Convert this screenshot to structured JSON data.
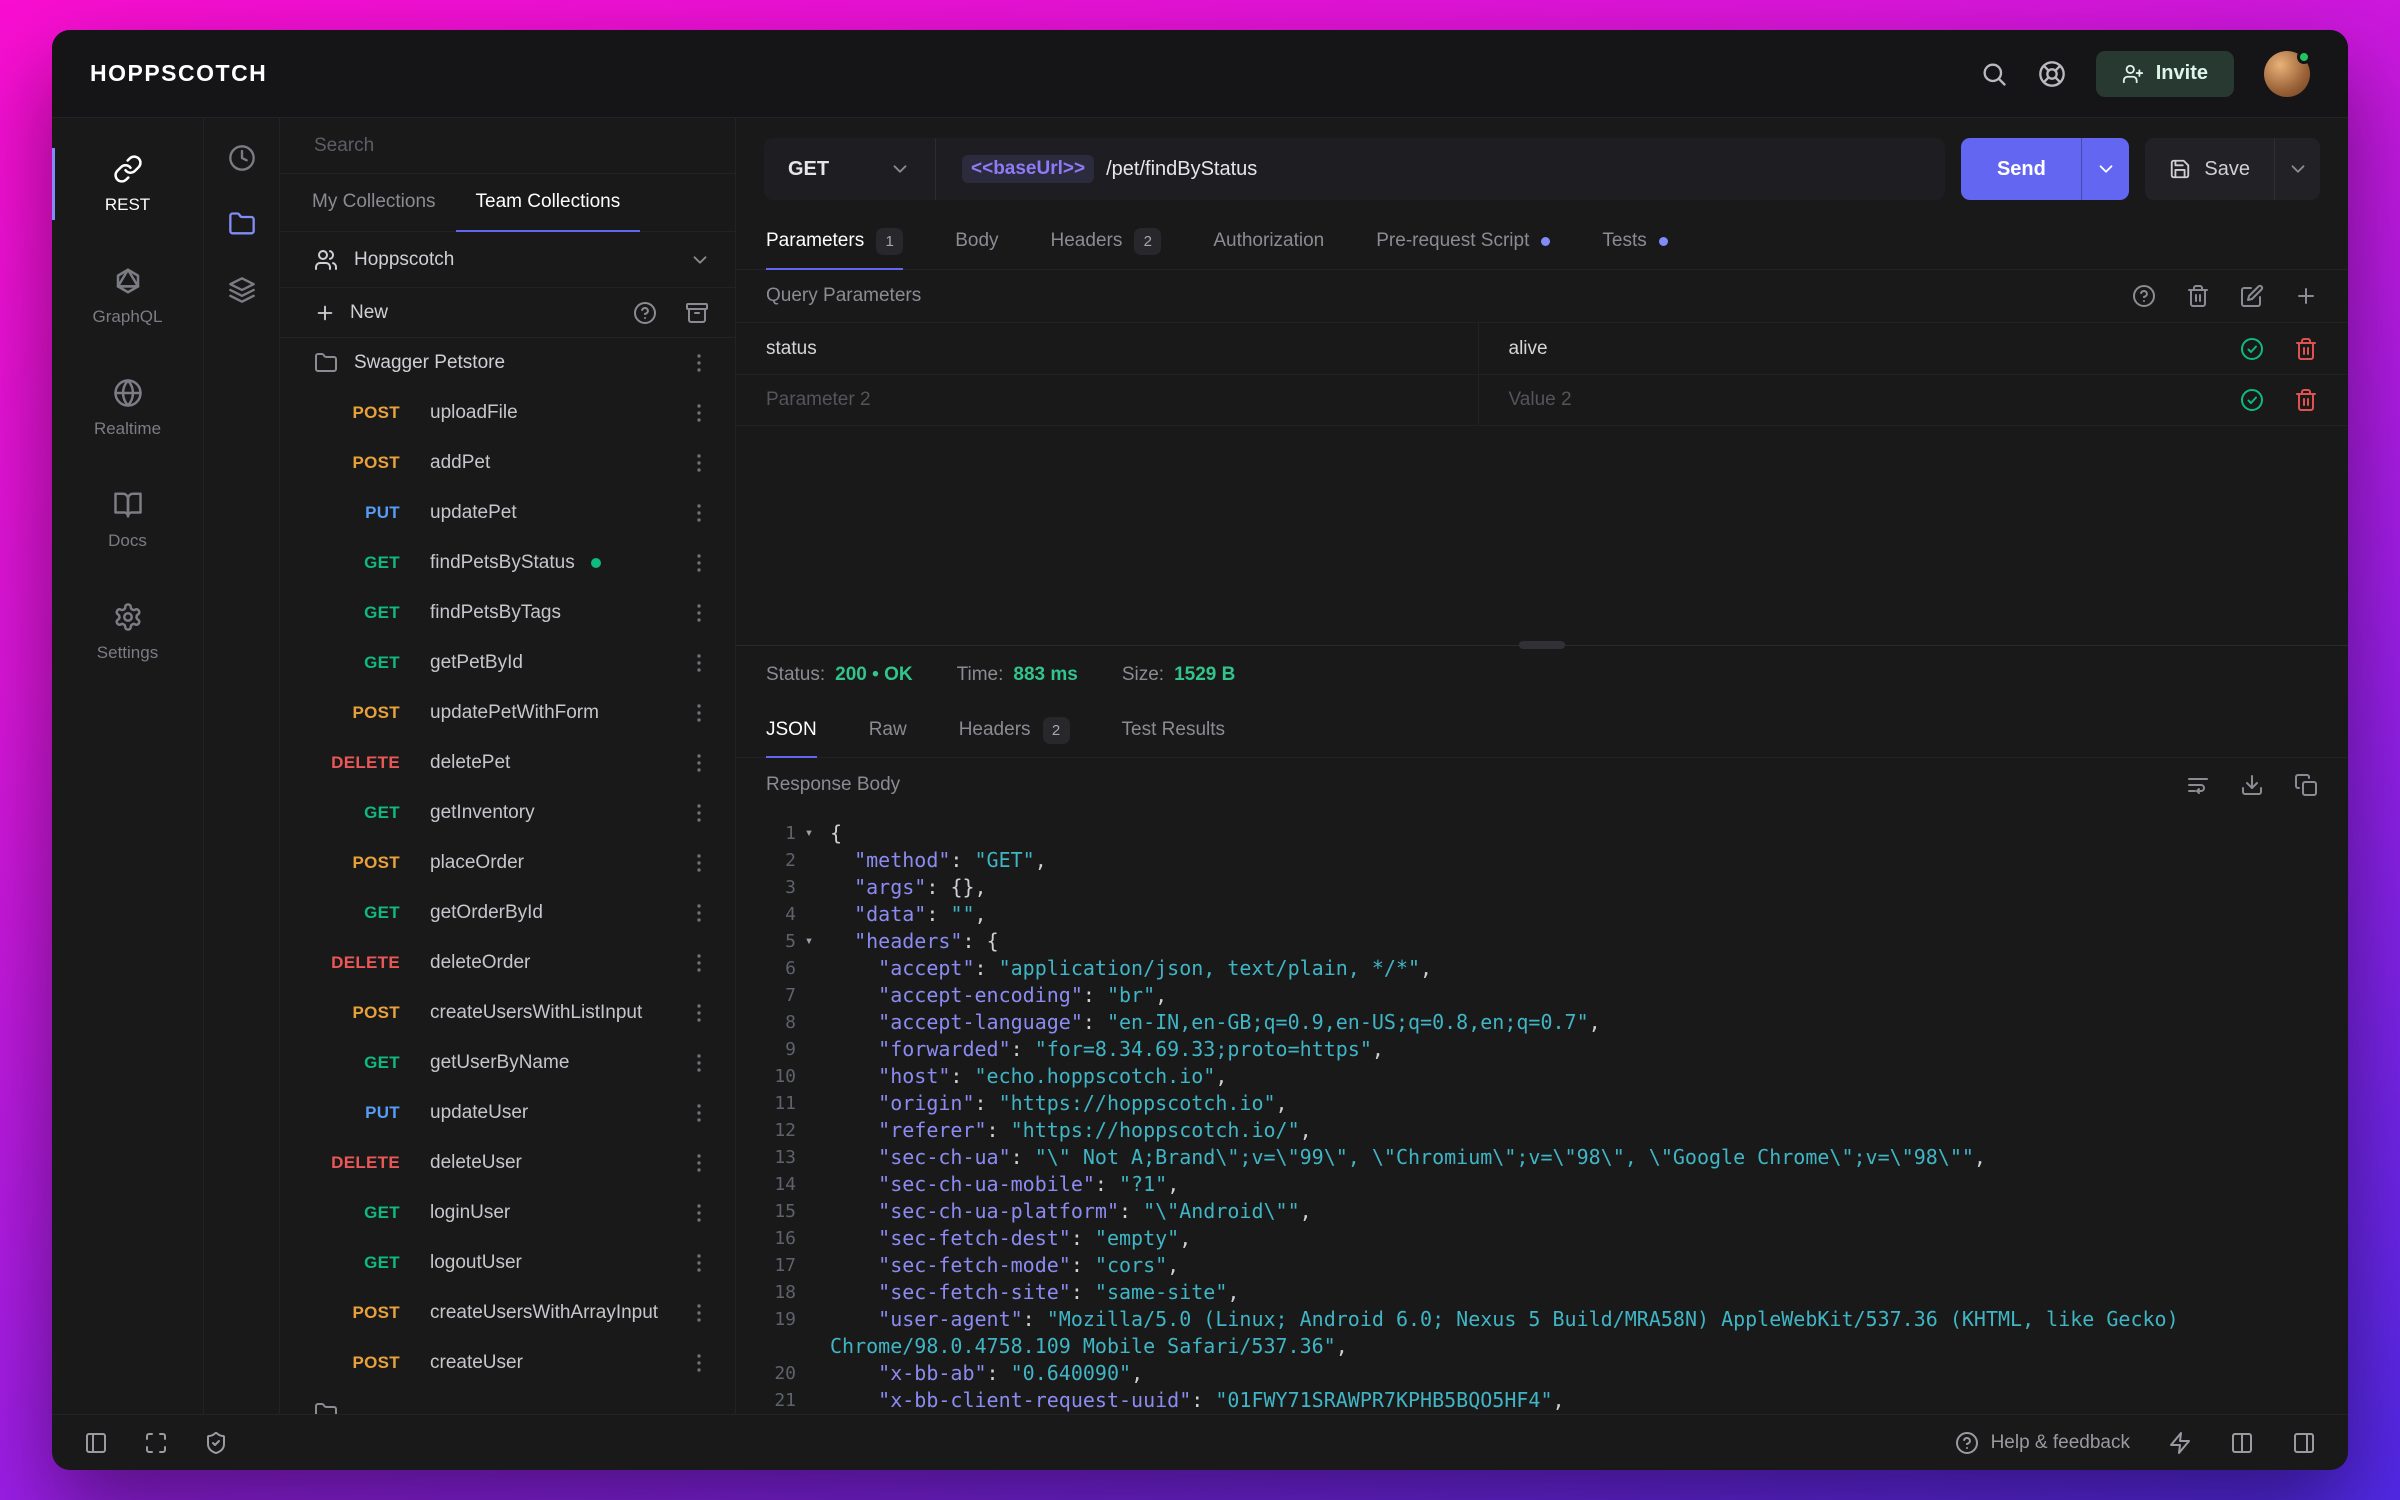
{
  "topbar": {
    "logo": "HOPPSCOTCH",
    "invite_label": "Invite"
  },
  "nav": {
    "items": [
      {
        "label": "REST",
        "icon": "link-icon",
        "active": true
      },
      {
        "label": "GraphQL",
        "icon": "graphql-icon",
        "active": false
      },
      {
        "label": "Realtime",
        "icon": "globe-icon",
        "active": false
      },
      {
        "label": "Docs",
        "icon": "book-icon",
        "active": false
      },
      {
        "label": "Settings",
        "icon": "gear-icon",
        "active": false
      }
    ]
  },
  "strip": {
    "items": [
      {
        "name": "history",
        "icon": "clock-icon",
        "active": false
      },
      {
        "name": "collections",
        "icon": "folder-icon",
        "active": true
      },
      {
        "name": "environments",
        "icon": "layers-icon",
        "active": false
      }
    ]
  },
  "collections": {
    "search_placeholder": "Search",
    "tabs": [
      {
        "label": "My Collections",
        "active": false
      },
      {
        "label": "Team Collections",
        "active": true
      }
    ],
    "team_name": "Hoppscotch",
    "new_label": "New",
    "folder_name": "Swagger Petstore",
    "requests": [
      {
        "method": "POST",
        "name": "uploadFile"
      },
      {
        "method": "POST",
        "name": "addPet"
      },
      {
        "method": "PUT",
        "name": "updatePet"
      },
      {
        "method": "GET",
        "name": "findPetsByStatus",
        "active": true
      },
      {
        "method": "GET",
        "name": "findPetsByTags"
      },
      {
        "method": "GET",
        "name": "getPetById"
      },
      {
        "method": "POST",
        "name": "updatePetWithForm"
      },
      {
        "method": "DELETE",
        "name": "deletePet"
      },
      {
        "method": "GET",
        "name": "getInventory"
      },
      {
        "method": "POST",
        "name": "placeOrder"
      },
      {
        "method": "GET",
        "name": "getOrderById"
      },
      {
        "method": "DELETE",
        "name": "deleteOrder"
      },
      {
        "method": "POST",
        "name": "createUsersWithListInput"
      },
      {
        "method": "GET",
        "name": "getUserByName"
      },
      {
        "method": "PUT",
        "name": "updateUser"
      },
      {
        "method": "DELETE",
        "name": "deleteUser"
      },
      {
        "method": "GET",
        "name": "loginUser"
      },
      {
        "method": "GET",
        "name": "logoutUser"
      },
      {
        "method": "POST",
        "name": "createUsersWithArrayInput"
      },
      {
        "method": "POST",
        "name": "createUser"
      }
    ],
    "has_partial_row": true
  },
  "request": {
    "method": "GET",
    "url_token": "<<baseUrl>>",
    "url_path": "/pet/findByStatus",
    "send_label": "Send",
    "save_label": "Save",
    "tabs": [
      {
        "label": "Parameters",
        "badge": "1",
        "active": true
      },
      {
        "label": "Body"
      },
      {
        "label": "Headers",
        "badge": "2"
      },
      {
        "label": "Authorization"
      },
      {
        "label": "Pre-request Script",
        "dot": true
      },
      {
        "label": "Tests",
        "dot": true
      }
    ],
    "section_title": "Query Parameters",
    "params": [
      {
        "key": "status",
        "value": "alive",
        "placeholder": false
      },
      {
        "key": "Parameter 2",
        "value": "Value 2",
        "placeholder": true
      }
    ]
  },
  "response": {
    "meta": [
      {
        "label": "Status:",
        "value": "200 • OK"
      },
      {
        "label": "Time:",
        "value": "883 ms"
      },
      {
        "label": "Size:",
        "value": "1529 B"
      }
    ],
    "tabs": [
      {
        "label": "JSON",
        "active": true
      },
      {
        "label": "Raw"
      },
      {
        "label": "Headers",
        "badge": "2"
      },
      {
        "label": "Test Results"
      }
    ],
    "body_label": "Response Body",
    "code_lines": [
      {
        "raw": "{",
        "fold": true
      },
      {
        "ind": 1,
        "key": "method",
        "val": "\"GET\"",
        "end": ","
      },
      {
        "ind": 1,
        "key": "args",
        "pv": "{}",
        "end": ","
      },
      {
        "ind": 1,
        "key": "data",
        "val": "\"\"",
        "end": ","
      },
      {
        "ind": 1,
        "key": "headers",
        "pv": "{",
        "fold": true
      },
      {
        "ind": 2,
        "key": "accept",
        "val": "\"application/json, text/plain, */*\"",
        "end": ","
      },
      {
        "ind": 2,
        "key": "accept-encoding",
        "val": "\"br\"",
        "end": ","
      },
      {
        "ind": 2,
        "key": "accept-language",
        "val": "\"en-IN,en-GB;q=0.9,en-US;q=0.8,en;q=0.7\"",
        "end": ","
      },
      {
        "ind": 2,
        "key": "forwarded",
        "val": "\"for=8.34.69.33;proto=https\"",
        "end": ","
      },
      {
        "ind": 2,
        "key": "host",
        "val": "\"echo.hoppscotch.io\"",
        "end": ","
      },
      {
        "ind": 2,
        "key": "origin",
        "val": "\"https://hoppscotch.io\"",
        "end": ","
      },
      {
        "ind": 2,
        "key": "referer",
        "val": "\"https://hoppscotch.io/\"",
        "end": ","
      },
      {
        "ind": 2,
        "key": "sec-ch-ua",
        "val": "\"\\\" Not A;Brand\\\";v=\\\"99\\\", \\\"Chromium\\\";v=\\\"98\\\", \\\"Google Chrome\\\";v=\\\"98\\\"\"",
        "end": ","
      },
      {
        "ind": 2,
        "key": "sec-ch-ua-mobile",
        "val": "\"?1\"",
        "end": ","
      },
      {
        "ind": 2,
        "key": "sec-ch-ua-platform",
        "val": "\"\\\"Android\\\"\"",
        "end": ","
      },
      {
        "ind": 2,
        "key": "sec-fetch-dest",
        "val": "\"empty\"",
        "end": ","
      },
      {
        "ind": 2,
        "key": "sec-fetch-mode",
        "val": "\"cors\"",
        "end": ","
      },
      {
        "ind": 2,
        "key": "sec-fetch-site",
        "val": "\"same-site\"",
        "end": ","
      },
      {
        "ind": 2,
        "key": "user-agent",
        "val": "\"Mozilla/5.0 (Linux; Android 6.0; Nexus 5 Build/MRA58N) AppleWebKit/537.36 (KHTML, like Gecko) Chrome/98.0.4758.109 Mobile Safari/537.36\"",
        "end": ","
      },
      {
        "ind": 2,
        "key": "x-bb-ab",
        "val": "\"0.640090\"",
        "end": ","
      },
      {
        "ind": 2,
        "key": "x-bb-client-request-uuid",
        "val": "\"01FWY71SRAWPR7KPHB5BQO5HF4\"",
        "end": ","
      }
    ]
  },
  "footer": {
    "help_label": "Help & feedback"
  },
  "colors": {
    "accent": "#6366f1",
    "method": {
      "GET": "#10b981",
      "POST": "#e9a13b",
      "PUT": "#569cf6",
      "DELETE": "#eb5757"
    },
    "status_ok": "#31c48d",
    "url_token": "#8b7cf6",
    "code_key": "#8b8bf2",
    "code_string": "#3fb5c5"
  }
}
